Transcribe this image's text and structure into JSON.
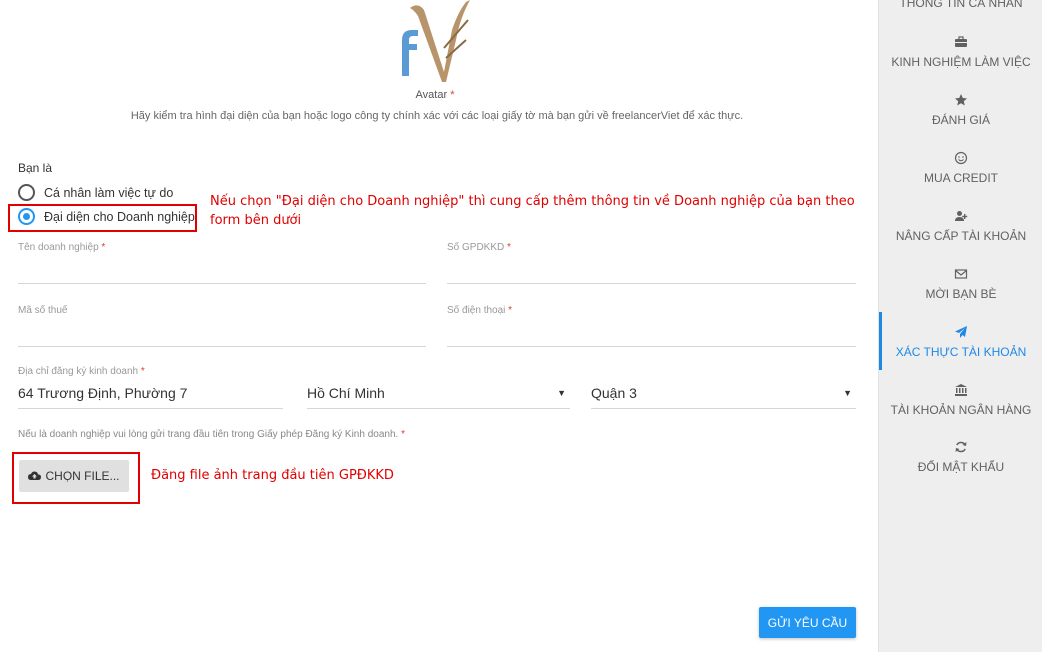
{
  "avatar": {
    "label": "Avatar",
    "required_mark": "*",
    "hint": "Hãy kiểm tra hình đại diện của bạn hoặc logo công ty chính xác với các loại giấy tờ mà bạn gửi về freelancerViet để xác thực."
  },
  "identity": {
    "label": "Bạn là",
    "options": [
      {
        "label": "Cá nhân làm việc tự do",
        "checked": false
      },
      {
        "label": "Đại diện cho Doanh nghiệp",
        "checked": true
      }
    ]
  },
  "annotations": {
    "radio_note": "Nếu chọn \"Đại diện cho Doanh nghiệp\" thì cung cấp thêm thông tin về Doanh nghiệp của bạn theo form bên dưới",
    "file_note": "Đăng file ảnh trang đầu tiên GPĐKKD"
  },
  "form": {
    "company_name": {
      "label": "Tên doanh nghiệp",
      "required": "*",
      "value": ""
    },
    "license_no": {
      "label": "Số GPDKKD",
      "required": "*",
      "value": ""
    },
    "tax_code": {
      "label": "Mã số thuế",
      "value": ""
    },
    "phone": {
      "label": "Số điện thoại",
      "required": "*",
      "value": ""
    },
    "address": {
      "label": "Địa chỉ đăng ký kinh doanh",
      "required": "*",
      "value": "64 Trương Định, Phường 7"
    },
    "city": {
      "value": "Hồ Chí Minh",
      "caret": "▼"
    },
    "district": {
      "value": "Quận 3",
      "caret": "▼"
    },
    "file_instruction": "Nếu là doanh nghiệp vui lòng gửi trang đầu tiên trong Giấy phép Đăng ký Kinh doanh.",
    "file_required": "*",
    "file_button": "CHỌN FILE...",
    "submit": "GỬI YÊU CẦU"
  },
  "sidebar": {
    "items": [
      {
        "label": "THÔNG TIN CÁ NHÂN",
        "icon": "user-icon",
        "active": false
      },
      {
        "label": "KINH NGHIỆM LÀM VIỆC",
        "icon": "briefcase-icon",
        "active": false
      },
      {
        "label": "ĐÁNH GIÁ",
        "icon": "star-icon",
        "active": false
      },
      {
        "label": "MUA CREDIT",
        "icon": "smile-icon",
        "active": false
      },
      {
        "label": "NÂNG CẤP TÀI KHOẢN",
        "icon": "user-plus-icon",
        "active": false
      },
      {
        "label": "MỜI BẠN BÈ",
        "icon": "envelope-icon",
        "active": false
      },
      {
        "label": "XÁC THỰC TÀI KHOẢN",
        "icon": "paper-plane-icon",
        "active": true
      },
      {
        "label": "TÀI KHOẢN NGÂN HÀNG",
        "icon": "bank-icon",
        "active": false
      },
      {
        "label": "ĐỔI MẬT KHẨU",
        "icon": "refresh-icon",
        "active": false
      }
    ]
  },
  "colors": {
    "accent": "#2196f3",
    "annotation_red": "#e00000",
    "sidebar_bg": "#eeeeee",
    "logo_brown": "#b8946a",
    "logo_blue": "#5b9bd5"
  }
}
